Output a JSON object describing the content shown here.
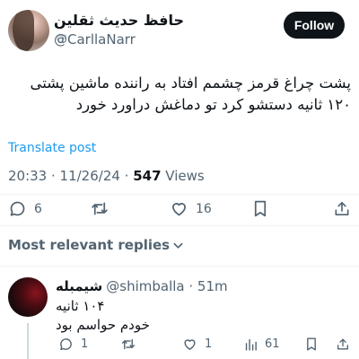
{
  "author": {
    "display_name": "حافظ حدیث ثقلین",
    "handle": "@CarllaNarr"
  },
  "follow_label": "Follow",
  "tweet": {
    "lines": [
      "پشت چراغ قرمز چشمم افتاد به راننده ماشین پشتی",
      "۱۲۰ ثانیه دستشو کرد تو دماغش دراورد خورد"
    ],
    "translate_label": "Translate post",
    "time": "20:33 · 11/26/24 · ",
    "views_count": "547",
    "views_label": " Views",
    "replies": "6",
    "likes": "16"
  },
  "sort_label": "Most relevant replies",
  "reply": {
    "name": "شیمبله",
    "handle": "@shimballa · 51m",
    "lines": [
      "۱۰۴ ثانیه",
      "خودم حواسم بود"
    ],
    "replies": "1",
    "likes": "1",
    "views": "61"
  },
  "colors": {
    "accent": "#1d9bf0",
    "text": "#0f1419",
    "secondary": "#536471"
  }
}
